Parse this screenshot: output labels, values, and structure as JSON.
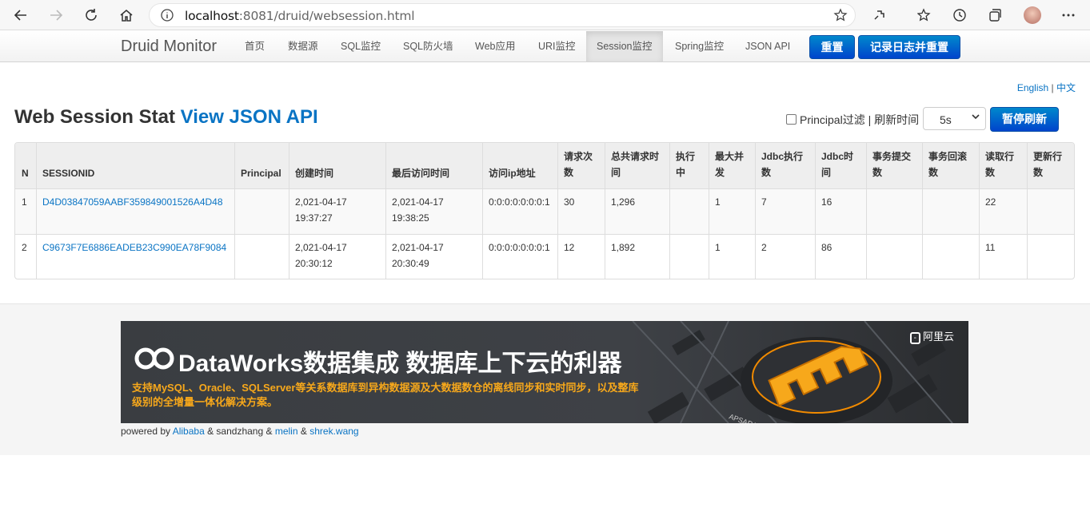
{
  "browser": {
    "url_host": "localhost",
    "url_rest": ":8081/druid/websession.html"
  },
  "nav": {
    "brand": "Druid Monitor",
    "items": [
      "首页",
      "数据源",
      "SQL监控",
      "SQL防火墙",
      "Web应用",
      "URI监控",
      "Session监控",
      "Spring监控",
      "JSON API"
    ],
    "reset": "重置",
    "log_reset": "记录日志并重置"
  },
  "lang": {
    "en": "English",
    "sep": "|",
    "zh": "中文"
  },
  "page": {
    "title": "Web Session Stat",
    "api_link": "View JSON API",
    "principal_filter": "Principal过滤 | 刷新时间",
    "refresh_value": "5s",
    "pause": "暂停刷新"
  },
  "table": {
    "headers": [
      [
        "N"
      ],
      [
        "SESSIONID"
      ],
      [
        "Principal"
      ],
      [
        "创建时间"
      ],
      [
        "最后访问时间"
      ],
      [
        "访问ip地址"
      ],
      [
        "请求次",
        "数"
      ],
      [
        "总共请求时",
        "间"
      ],
      [
        "执行",
        "中"
      ],
      [
        "最大并",
        "发"
      ],
      [
        "Jdbc执行",
        "数"
      ],
      [
        "Jdbc时",
        "间"
      ],
      [
        "事务提交",
        "数"
      ],
      [
        "事务回滚",
        "数"
      ],
      [
        "读取行",
        "数"
      ],
      [
        "更新行",
        "数"
      ]
    ],
    "rows": [
      {
        "n": "1",
        "session": "D4D03847059AABF359849001526A4D48",
        "principal": "",
        "created": [
          "2,021-04-17",
          "19:37:27"
        ],
        "last": [
          "2,021-04-17",
          "19:38:25"
        ],
        "ip": "0:0:0:0:0:0:0:1",
        "req": "30",
        "total_time": "1,296",
        "running": "",
        "max_conc": "1",
        "jdbc_exec": "7",
        "jdbc_time": "16",
        "tx_commit": "",
        "tx_rollback": "",
        "read_rows": "22",
        "update_rows": ""
      },
      {
        "n": "2",
        "session": "C9673F7E6886EADEB23C990EA78F9084",
        "principal": "",
        "created": [
          "2,021-04-17",
          "20:30:12"
        ],
        "last": [
          "2,021-04-17",
          "20:30:49"
        ],
        "ip": "0:0:0:0:0:0:0:1",
        "req": "12",
        "total_time": "1,892",
        "running": "",
        "max_conc": "1",
        "jdbc_exec": "2",
        "jdbc_time": "86",
        "tx_commit": "",
        "tx_rollback": "",
        "read_rows": "11",
        "update_rows": ""
      }
    ]
  },
  "banner": {
    "title": "DataWorks数据集成 数据库上下云的利器",
    "sub": "支持MySQL、Oracle、SQLServer等关系数据库到异构数据源及大数据数仓的离线同步和实时同步，以及整库级别的全增量一体化解决方案。",
    "logo": "阿里云"
  },
  "footer": {
    "powered": "powered by",
    "alibaba": "Alibaba",
    "amp1": "& sandzhang &",
    "melin": "melin",
    "amp2": "&",
    "shrek": "shrek.wang"
  }
}
